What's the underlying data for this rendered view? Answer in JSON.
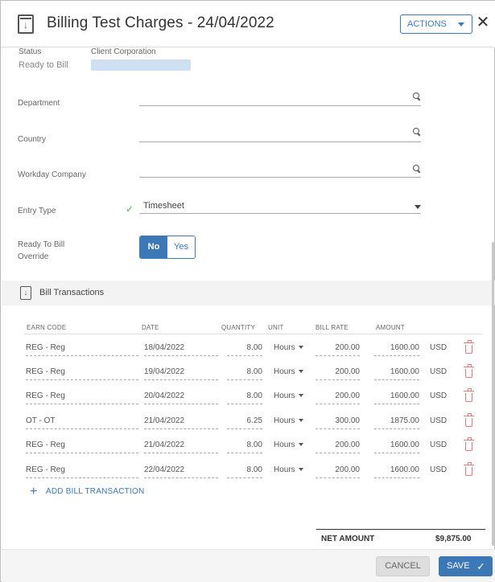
{
  "header": {
    "title": "Billing Test Charges - 24/04/2022",
    "actions_label": "ACTIONS",
    "close_glyph": "✕",
    "doc_icon": "document-download-icon"
  },
  "status": {
    "status_label": "Status",
    "status_value": "Ready to Bill",
    "client_label": "Client Corporation",
    "client_value": ""
  },
  "form": {
    "department_label": "Department",
    "country_label": "Country",
    "workday_label": "Workday Company",
    "entry_type_label": "Entry Type",
    "entry_type_value": "Timesheet",
    "override_label_line1": "Ready To Bill",
    "override_label_line2": "Override",
    "toggle_no": "No",
    "toggle_yes": "Yes",
    "toggle_selected": "No"
  },
  "transactions": {
    "section_title": "Bill Transactions",
    "columns": [
      "EARN CODE",
      "DATE",
      "QUANTITY",
      "UNIT",
      "BILL RATE",
      "AMOUNT"
    ],
    "rows": [
      {
        "earn_code": "REG - Reg",
        "date": "18/04/2022",
        "quantity": "8.00",
        "unit": "Hours",
        "bill_rate": "200.00",
        "amount": "1600.00",
        "currency": "USD"
      },
      {
        "earn_code": "REG - Reg",
        "date": "19/04/2022",
        "quantity": "8.00",
        "unit": "Hours",
        "bill_rate": "200.00",
        "amount": "1600.00",
        "currency": "USD"
      },
      {
        "earn_code": "REG - Reg",
        "date": "20/04/2022",
        "quantity": "8.00",
        "unit": "Hours",
        "bill_rate": "200.00",
        "amount": "1600.00",
        "currency": "USD"
      },
      {
        "earn_code": "OT - OT",
        "date": "21/04/2022",
        "quantity": "6.25",
        "unit": "Hours",
        "bill_rate": "300.00",
        "amount": "1875.00",
        "currency": "USD"
      },
      {
        "earn_code": "REG - Reg",
        "date": "21/04/2022",
        "quantity": "8.00",
        "unit": "Hours",
        "bill_rate": "200.00",
        "amount": "1600.00",
        "currency": "USD"
      },
      {
        "earn_code": "REG - Reg",
        "date": "22/04/2022",
        "quantity": "8.00",
        "unit": "Hours",
        "bill_rate": "200.00",
        "amount": "1600.00",
        "currency": "USD"
      }
    ],
    "add_plus": "+",
    "add_label": "ADD BILL TRANSACTION",
    "net_label": "NET AMOUNT",
    "net_value": "$9,875.00"
  },
  "footer": {
    "cancel_label": "CANCEL",
    "save_label": "SAVE",
    "save_icon": "✓"
  },
  "colors": {
    "accent": "#3b78b5",
    "success": "#4caf50",
    "delete": "#e07b7b"
  }
}
